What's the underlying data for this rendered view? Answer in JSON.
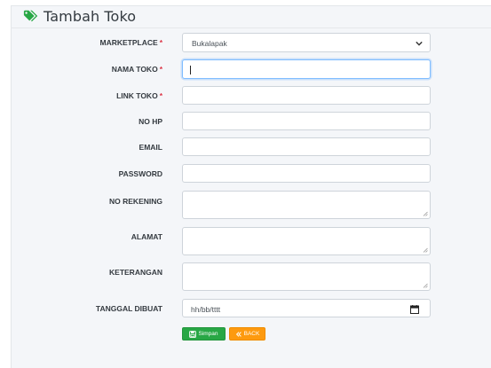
{
  "page": {
    "title": "Tambah Toko",
    "title_icon": "tags-icon",
    "accent_color": "#28a745",
    "required_color": "#dc3545"
  },
  "form": {
    "required_mark": "*",
    "marketplace": {
      "label": "MARKETPLACE",
      "value": "Bukalapak",
      "icon": "chevron-down-icon"
    },
    "nama_toko": {
      "label": "NAMA TOKO",
      "value": ""
    },
    "link_toko": {
      "label": "LINK TOKO",
      "value": ""
    },
    "no_hp": {
      "label": "NO HP",
      "value": ""
    },
    "email": {
      "label": "EMAIL",
      "value": ""
    },
    "password": {
      "label": "PASSWORD",
      "value": ""
    },
    "no_rekening": {
      "label": "NO REKENING",
      "value": ""
    },
    "alamat": {
      "label": "ALAMAT",
      "value": ""
    },
    "keterangan": {
      "label": "KETERANGAN",
      "value": ""
    },
    "tanggal_dibuat": {
      "label": "TANGGAL DIBUAT",
      "placeholder": "hh/bb/tttt",
      "icon": "calendar-icon"
    }
  },
  "actions": {
    "save_label": "Simpan",
    "save_icon": "save-icon",
    "back_label": "BACK",
    "back_icon": "double-chevron-left-icon",
    "save_color": "#28a745",
    "back_color": "#fd9a0f"
  }
}
